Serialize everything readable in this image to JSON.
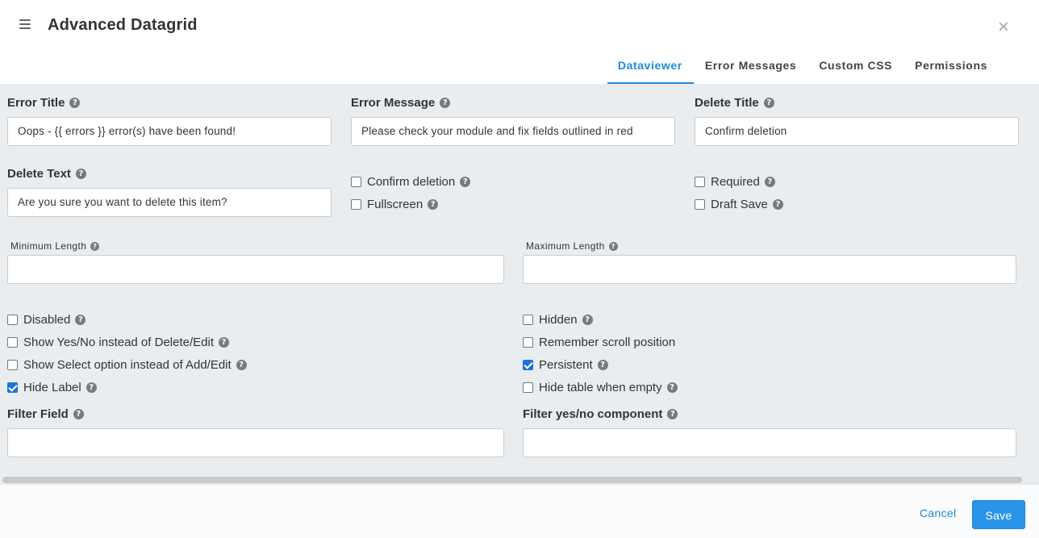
{
  "header": {
    "title": "Advanced Datagrid",
    "close_glyph": "×",
    "tabs": [
      {
        "label": "Dataviewer",
        "active": true
      },
      {
        "label": "Error Messages",
        "active": false
      },
      {
        "label": "Custom CSS",
        "active": false
      },
      {
        "label": "Permissions",
        "active": false
      }
    ]
  },
  "form": {
    "error_title": {
      "label": "Error Title",
      "value": "Oops - {{ errors }} error(s) have been found!"
    },
    "error_message": {
      "label": "Error Message",
      "value": "Please check your module and fix fields outlined in red"
    },
    "delete_title": {
      "label": "Delete Title",
      "value": "Confirm deletion"
    },
    "delete_text": {
      "label": "Delete Text",
      "value": "Are you sure you want to delete this item?"
    },
    "confirm_deletion": {
      "label": "Confirm deletion",
      "checked": false
    },
    "fullscreen": {
      "label": "Fullscreen",
      "checked": false
    },
    "required": {
      "label": "Required",
      "checked": false
    },
    "draft_save": {
      "label": "Draft Save",
      "checked": false
    },
    "minimum_length": {
      "label": "Minimum Length",
      "value": ""
    },
    "maximum_length": {
      "label": "Maximum Length",
      "value": ""
    },
    "disabled": {
      "label": "Disabled",
      "checked": false
    },
    "show_yes_no": {
      "label": "Show Yes/No instead of Delete/Edit",
      "checked": false
    },
    "show_select_option": {
      "label": "Show Select option instead of Add/Edit",
      "checked": false
    },
    "hide_label": {
      "label": "Hide Label",
      "checked": true
    },
    "hidden": {
      "label": "Hidden",
      "checked": false
    },
    "remember_scroll": {
      "label": "Remember scroll position",
      "checked": false
    },
    "persistent": {
      "label": "Persistent",
      "checked": true
    },
    "hide_table_empty": {
      "label": "Hide table when empty",
      "checked": false
    },
    "filter_field": {
      "label": "Filter Field",
      "value": ""
    },
    "filter_yes_no": {
      "label": "Filter yes/no component",
      "value": ""
    }
  },
  "footer": {
    "cancel_label": "Cancel",
    "save_label": "Save"
  },
  "colors": {
    "accent": "#1f8ad9",
    "body_bg": "#eaedf0",
    "save_bg": "#2a94e8"
  },
  "help_glyph": "?"
}
